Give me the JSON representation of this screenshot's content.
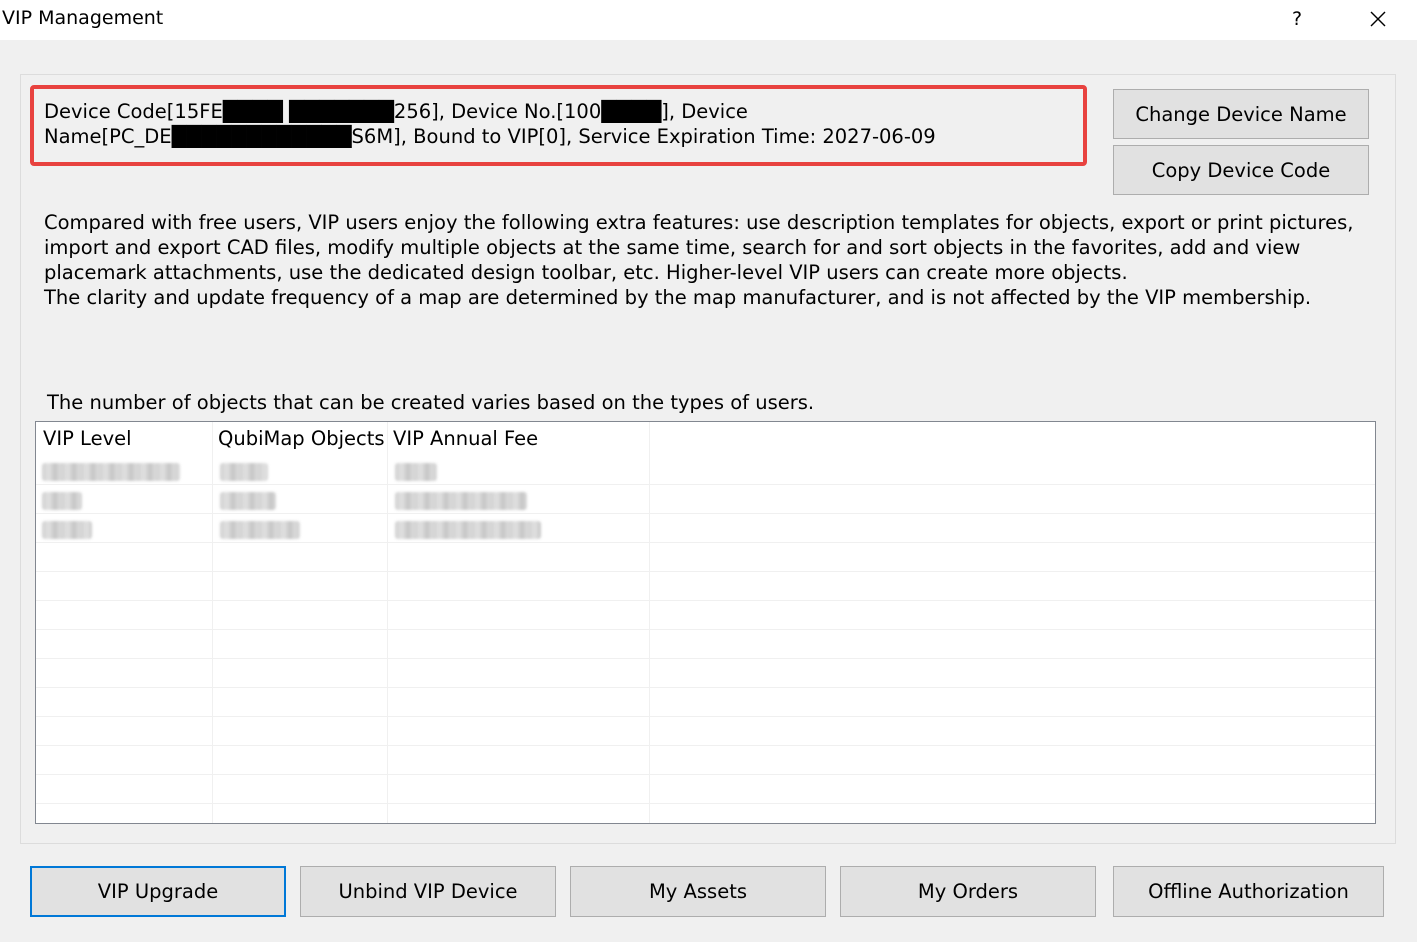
{
  "window": {
    "title": "VIP Management",
    "help_label": "?"
  },
  "device_info": {
    "text": "Device Code[15FE████ ███████256], Device No.[100████], Device Name[PC_DE████████████S6M], Bound to VIP[0], Service Expiration Time: 2027-06-09"
  },
  "side_buttons": {
    "change_device_name": "Change Device Name",
    "copy_device_code": "Copy Device Code"
  },
  "description": {
    "paragraph_1": "Compared with free users, VIP users enjoy the following extra features: use description templates for objects, export or print pictures, import and export CAD files, modify multiple objects at the same time, search for and sort objects in the favorites, add and view placemark attachments, use the dedicated design toolbar, etc. Higher-level VIP users can create more objects.",
    "paragraph_2": "The clarity and update frequency of a map are determined by the map manufacturer, and is not affected by the VIP membership."
  },
  "table": {
    "caption": "The number of objects that can be created varies based on the types of users.",
    "columns": [
      "VIP Level",
      "QubiMap Objects",
      "VIP Annual Fee"
    ],
    "rows_note_hidden": 3
  },
  "bottom_buttons": {
    "vip_upgrade": "VIP Upgrade",
    "unbind_vip_device": "Unbind VIP Device",
    "my_assets": "My Assets",
    "my_orders": "My Orders",
    "offline_authorization": "Offline Authorization"
  },
  "colors": {
    "highlight_border": "#e8423f",
    "default_button_border": "#0078d7",
    "dialog_background": "#f0f0f0"
  },
  "icons": {
    "close": "close-icon"
  }
}
